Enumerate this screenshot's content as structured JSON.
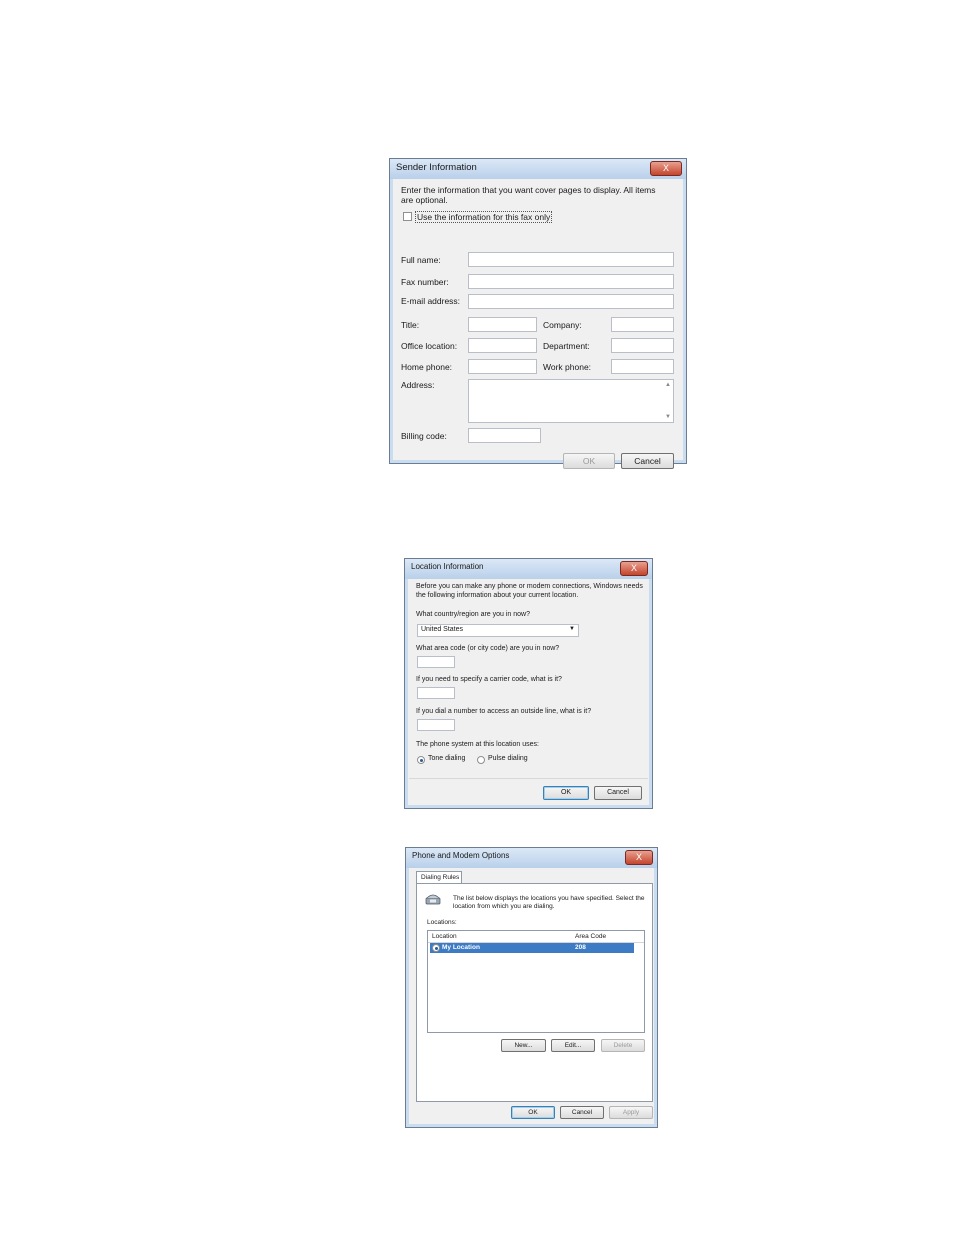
{
  "sender_dialog": {
    "title": "Sender Information",
    "close": "X",
    "intro": "Enter the information that you want cover pages to display. All items are optional.",
    "checkbox_label": "Use the information for this fax only",
    "labels": {
      "full_name": "Full name:",
      "fax_number": "Fax number:",
      "email": "E-mail address:",
      "title": "Title:",
      "company": "Company:",
      "office_location": "Office location:",
      "department": "Department:",
      "home_phone": "Home phone:",
      "work_phone": "Work phone:",
      "address": "Address:",
      "billing_code": "Billing code:"
    },
    "ok": "OK",
    "cancel": "Cancel"
  },
  "location_dialog": {
    "title": "Location Information",
    "close": "X",
    "intro": "Before you can make any phone or modem connections, Windows needs the following information about your current location.",
    "q_country": "What country/region are you in now?",
    "country_value": "United States",
    "q_area": "What area code (or city code) are you in now?",
    "q_carrier": "If you need to specify a carrier code, what is it?",
    "q_outside": "If you dial a number to access an outside line, what is it?",
    "q_phone_system": "The phone system at this location uses:",
    "tone": "Tone dialing",
    "pulse": "Pulse dialing",
    "ok": "OK",
    "cancel": "Cancel"
  },
  "phone_dialog": {
    "title": "Phone and Modem Options",
    "close": "X",
    "tab": "Dialing Rules",
    "desc": "The list below displays the locations you have specified. Select the location from which you are dialing.",
    "locations_label": "Locations:",
    "col_location": "Location",
    "col_area": "Area Code",
    "row_location": "My Location",
    "row_area": "208",
    "new": "New...",
    "edit": "Edit...",
    "delete": "Delete",
    "ok": "OK",
    "cancel": "Cancel",
    "apply": "Apply"
  }
}
